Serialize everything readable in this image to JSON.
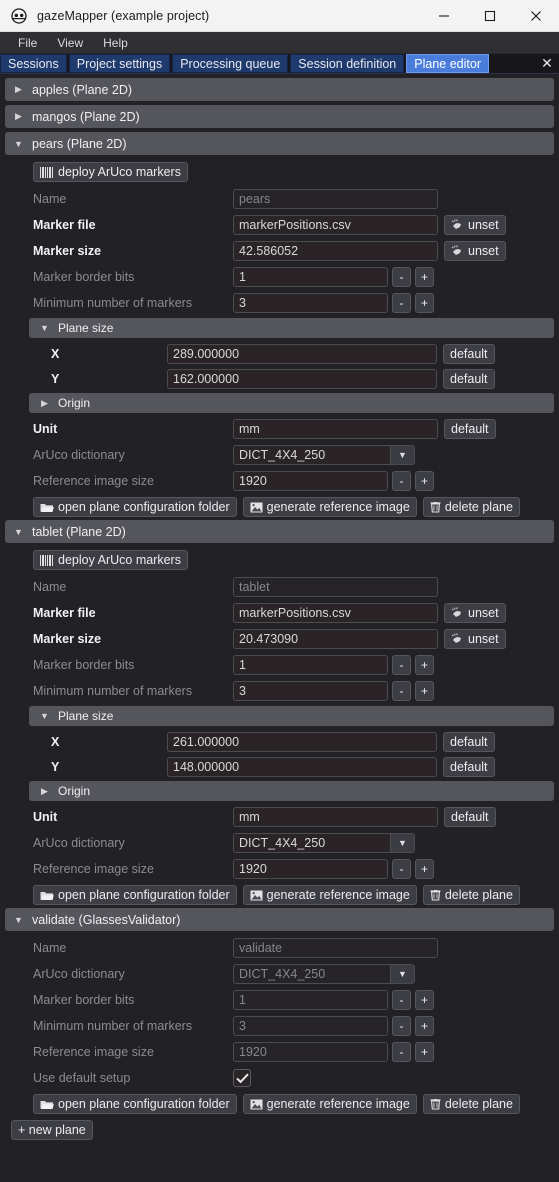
{
  "window": {
    "title": "gazeMapper (example project)",
    "icon": "glasses-icon",
    "minimize": "—",
    "maximize": "☐",
    "close": "✕"
  },
  "menubar": {
    "items": [
      "File",
      "View",
      "Help"
    ]
  },
  "tabs": {
    "items": [
      {
        "label": "Sessions",
        "active": false
      },
      {
        "label": "Project settings",
        "active": false
      },
      {
        "label": "Processing queue",
        "active": false
      },
      {
        "label": "Session definition",
        "active": false
      },
      {
        "label": "Plane editor",
        "active": true
      }
    ],
    "close_label": "✕",
    "active_color": "#4a7ddb",
    "inactive_color": "#1f3a6d"
  },
  "labels": {
    "name": "Name",
    "marker_file": "Marker file",
    "marker_size": "Marker size",
    "marker_border_bits": "Marker border bits",
    "minimum_number_of_markers": "Minimum number of markers",
    "plane_size": "Plane size",
    "origin": "Origin",
    "x": "X",
    "y": "Y",
    "unit": "Unit",
    "aruco_dictionary": "ArUco dictionary",
    "reference_image_size": "Reference image size",
    "use_default_setup": "Use default setup"
  },
  "buttons": {
    "deploy": "deploy ArUco markers",
    "unset": "unset",
    "default": "default",
    "minus": "-",
    "plus": "+",
    "open_folder": "open plane configuration folder",
    "generate_image": "generate reference image",
    "delete_plane": "delete plane",
    "new_plane": "+ new plane"
  },
  "planes": [
    {
      "title": "apples (Plane 2D)",
      "expanded": false
    },
    {
      "title": "mangos (Plane 2D)",
      "expanded": false
    },
    {
      "title": "pears (Plane 2D)",
      "expanded": true,
      "name": "pears",
      "marker_file": "markerPositions.csv",
      "marker_size": "42.586052",
      "marker_border_bits": "1",
      "minimum_number_of_markers": "3",
      "plane_size_x": "289.000000",
      "plane_size_y": "162.000000",
      "unit": "mm",
      "aruco_dictionary": "DICT_4X4_250",
      "reference_image_size": "1920"
    },
    {
      "title": "tablet (Plane 2D)",
      "expanded": true,
      "name": "tablet",
      "marker_file": "markerPositions.csv",
      "marker_size": "20.473090",
      "marker_border_bits": "1",
      "minimum_number_of_markers": "3",
      "plane_size_x": "261.000000",
      "plane_size_y": "148.000000",
      "unit": "mm",
      "aruco_dictionary": "DICT_4X4_250",
      "reference_image_size": "1920"
    },
    {
      "title": "validate (GlassesValidator)",
      "expanded": true,
      "name": "validate",
      "aruco_dictionary": "DICT_4X4_250",
      "marker_border_bits": "1",
      "minimum_number_of_markers": "3",
      "reference_image_size": "1920",
      "use_default_setup": true
    }
  ],
  "colors": {
    "panel_bg": "#212126",
    "header_bg": "#55555c",
    "field_bg": "#2a2426",
    "accent": "#4a7ddb"
  }
}
